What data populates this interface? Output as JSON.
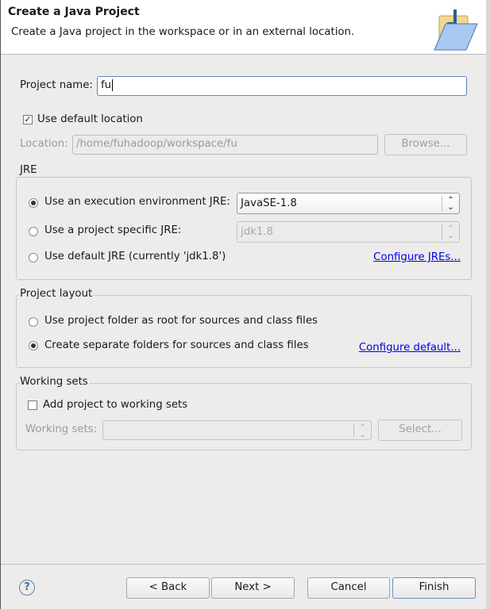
{
  "header": {
    "title": "Create a Java Project",
    "subtitle": "Create a Java project in the workspace or in an external location.",
    "icon": "java-project-folder-icon"
  },
  "project_name": {
    "label": "Project name:",
    "value": "fu"
  },
  "use_default_location": {
    "label": "Use default location",
    "checked": true
  },
  "location": {
    "label": "Location:",
    "value": "/home/fuhadoop/workspace/fu",
    "browse_label": "Browse..."
  },
  "jre": {
    "legend": "JRE",
    "options": [
      {
        "label": "Use an execution environment JRE:",
        "selected": true,
        "combo_value": "JavaSE-1.8"
      },
      {
        "label": "Use a project specific JRE:",
        "selected": false,
        "combo_value": "jdk1.8"
      },
      {
        "label": "Use default JRE (currently 'jdk1.8')",
        "selected": false
      }
    ],
    "configure_link": "Configure JREs..."
  },
  "layout": {
    "legend": "Project layout",
    "options": [
      {
        "label": "Use project folder as root for sources and class files",
        "selected": false
      },
      {
        "label": "Create separate folders for sources and class files",
        "selected": true
      }
    ],
    "configure_link": "Configure default..."
  },
  "working_sets": {
    "legend": "Working sets",
    "add_label": "Add project to working sets",
    "checked": false,
    "label": "Working sets:",
    "value": "",
    "select_label": "Select..."
  },
  "footer": {
    "back": "< Back",
    "next": "Next >",
    "cancel": "Cancel",
    "finish": "Finish",
    "help_icon": "help-icon"
  }
}
